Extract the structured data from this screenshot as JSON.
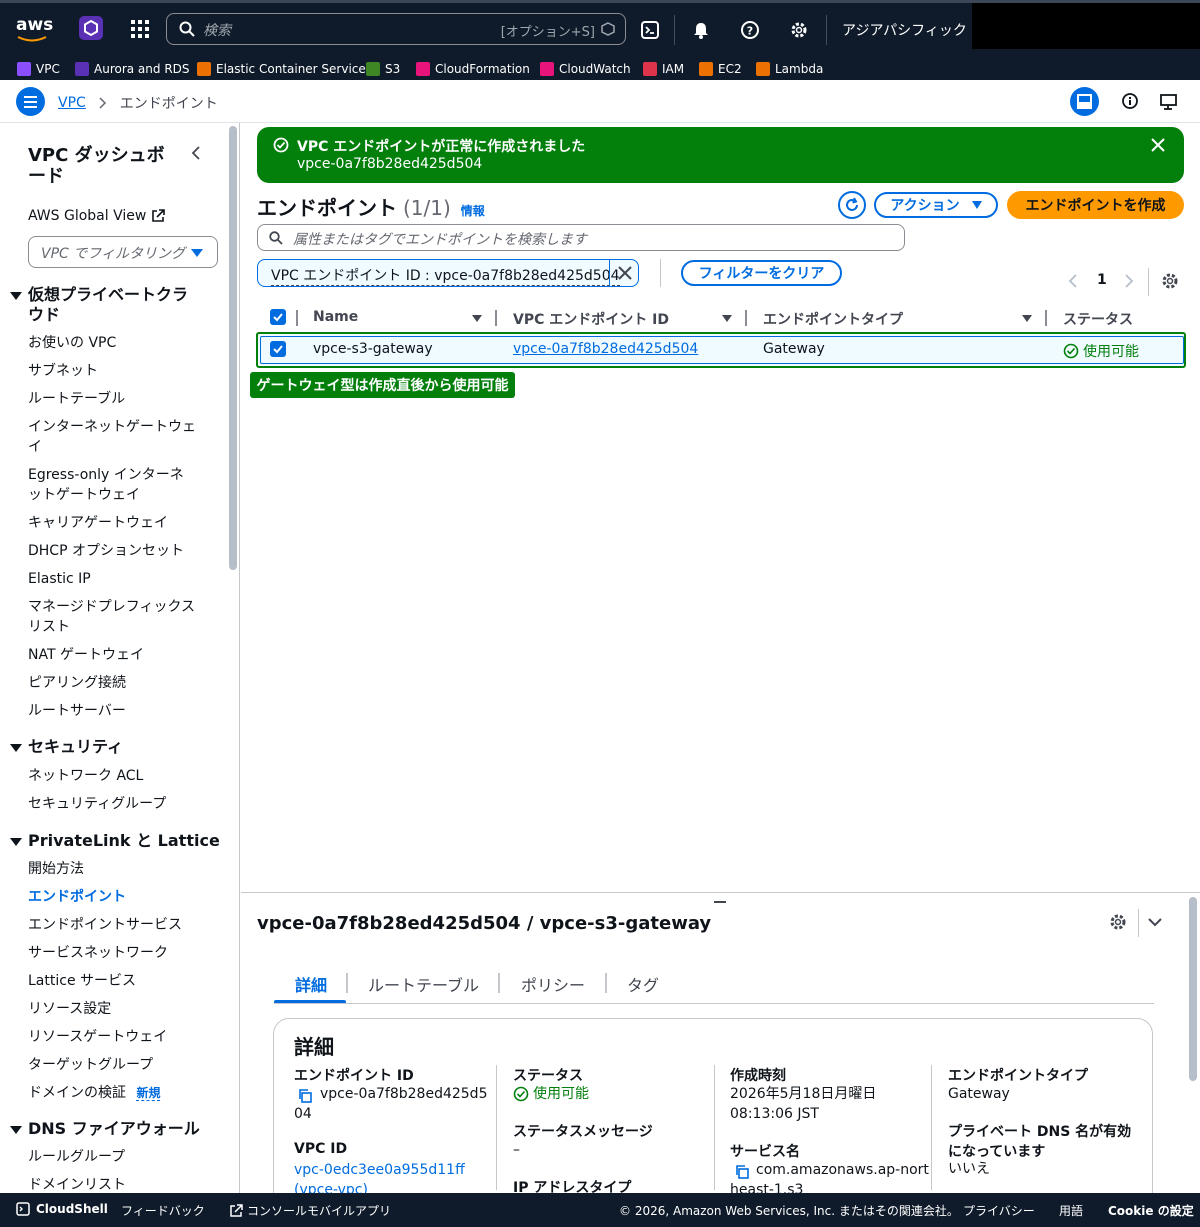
{
  "topnav": {
    "logo": "aws",
    "search_placeholder": "検索",
    "search_shortcut": "[オプション+S]",
    "region": "アジアパシフィック (東京)",
    "icons": [
      "grid-icon",
      "cloudshell-icon",
      "bell-icon",
      "help-icon",
      "gear-icon"
    ]
  },
  "favorites": [
    {
      "label": "VPC",
      "color": "#8c4fff"
    },
    {
      "label": "Aurora and RDS",
      "color": "#5a30b5"
    },
    {
      "label": "Elastic Container Service",
      "color": "#ed7100"
    },
    {
      "label": "S3",
      "color": "#3f8624"
    },
    {
      "label": "CloudFormation",
      "color": "#e7157b"
    },
    {
      "label": "CloudWatch",
      "color": "#e7157b"
    },
    {
      "label": "IAM",
      "color": "#dd344c"
    },
    {
      "label": "EC2",
      "color": "#ed7100"
    },
    {
      "label": "Lambda",
      "color": "#ed7100"
    }
  ],
  "breadcrumb": {
    "root": "VPC",
    "current": "エンドポイント"
  },
  "sidebar": {
    "title": "VPC ダッシュボード",
    "global_view": "AWS Global View",
    "filter_placeholder": "VPC でフィルタリング",
    "sections": [
      {
        "title": "仮想プライベートクラウド",
        "items": [
          "お使いの VPC",
          "サブネット",
          "ルートテーブル",
          "インターネットゲートウェイ",
          "Egress-only インターネットゲートウェイ",
          "キャリアゲートウェイ",
          "DHCP オプションセット",
          "Elastic IP",
          "マネージドプレフィックスリスト",
          "NAT ゲートウェイ",
          "ピアリング接続",
          "ルートサーバー"
        ]
      },
      {
        "title": "セキュリティ",
        "items": [
          "ネットワーク ACL",
          "セキュリティグループ"
        ]
      },
      {
        "title": "PrivateLink と Lattice",
        "items": [
          "開始方法",
          "エンドポイント",
          "エンドポイントサービス",
          "サービスネットワーク",
          "Lattice サービス",
          "リソース設定",
          "リソースゲートウェイ",
          "ターゲットグループ",
          "ドメインの検証"
        ]
      },
      {
        "title": "DNS ファイアウォール",
        "items": [
          "ルールグループ",
          "ドメインリスト"
        ]
      }
    ],
    "new_badge": "新規"
  },
  "flash": {
    "title": "VPC エンドポイントが正常に作成されました",
    "id": "vpce-0a7f8b28ed425d504",
    "color": "#037f0c"
  },
  "header": {
    "title": "エンドポイント",
    "count": "(1/1)",
    "info": "情報",
    "actions_label": "アクション",
    "create_label": "エンドポイントを作成",
    "accent": "#ff9900"
  },
  "search": {
    "placeholder": "属性またはタグでエンドポイントを検索します"
  },
  "filter": {
    "token": "VPC エンドポイント ID : vpce-0a7f8b28ed425d504",
    "clear_label": "フィルターをクリア"
  },
  "pagination": {
    "page": "1"
  },
  "table": {
    "columns": [
      "Name",
      "VPC エンドポイント ID",
      "エンドポイントタイプ",
      "ステータス"
    ],
    "rows": [
      {
        "name": "vpce-s3-gateway",
        "id": "vpce-0a7f8b28ed425d504",
        "type": "Gateway",
        "status": "使用可能"
      }
    ]
  },
  "annotation": "ゲートウェイ型は作成直後から使用可能",
  "detail": {
    "title": "vpce-0a7f8b28ed425d504 / vpce-s3-gateway",
    "tabs": [
      "詳細",
      "ルートテーブル",
      "ポリシー",
      "タグ"
    ],
    "section_title": "詳細",
    "endpoint_id_label": "エンドポイント ID",
    "endpoint_id_value_1": "vpce-0a7f8b28ed425d5",
    "endpoint_id_value_2": "04",
    "vpc_id_label": "VPC ID",
    "vpc_id_value": "vpc-0edc3ee0a955d11ff",
    "vpc_id_name": "(vpce-vpc)",
    "status_label": "ステータス",
    "status_value": "使用可能",
    "status_msg_label": "ステータスメッセージ",
    "status_msg_value": "–",
    "ip_type_label": "IP アドレスタイプ",
    "created_label": "作成時刻",
    "created_value_1": "2026年5月18日月曜日",
    "created_value_2": "08:13:06 JST",
    "service_label": "サービス名",
    "service_value_1": "com.amazonaws.ap-nort",
    "service_value_2": "heast-1.s3",
    "type_label": "エンドポイントタイプ",
    "type_value": "Gateway",
    "dns_label_1": "プライベート DNS 名が有効",
    "dns_label_2": "になっています",
    "dns_value": "いいえ"
  },
  "footer": {
    "cloudshell": "CloudShell",
    "feedback": "フィードバック",
    "mobile": "コンソールモバイルアプリ",
    "copyright": "© 2026, Amazon Web Services, Inc. またはその関連会社。",
    "privacy": "プライバシー",
    "terms": "用語",
    "cookie": "Cookie の設定"
  }
}
